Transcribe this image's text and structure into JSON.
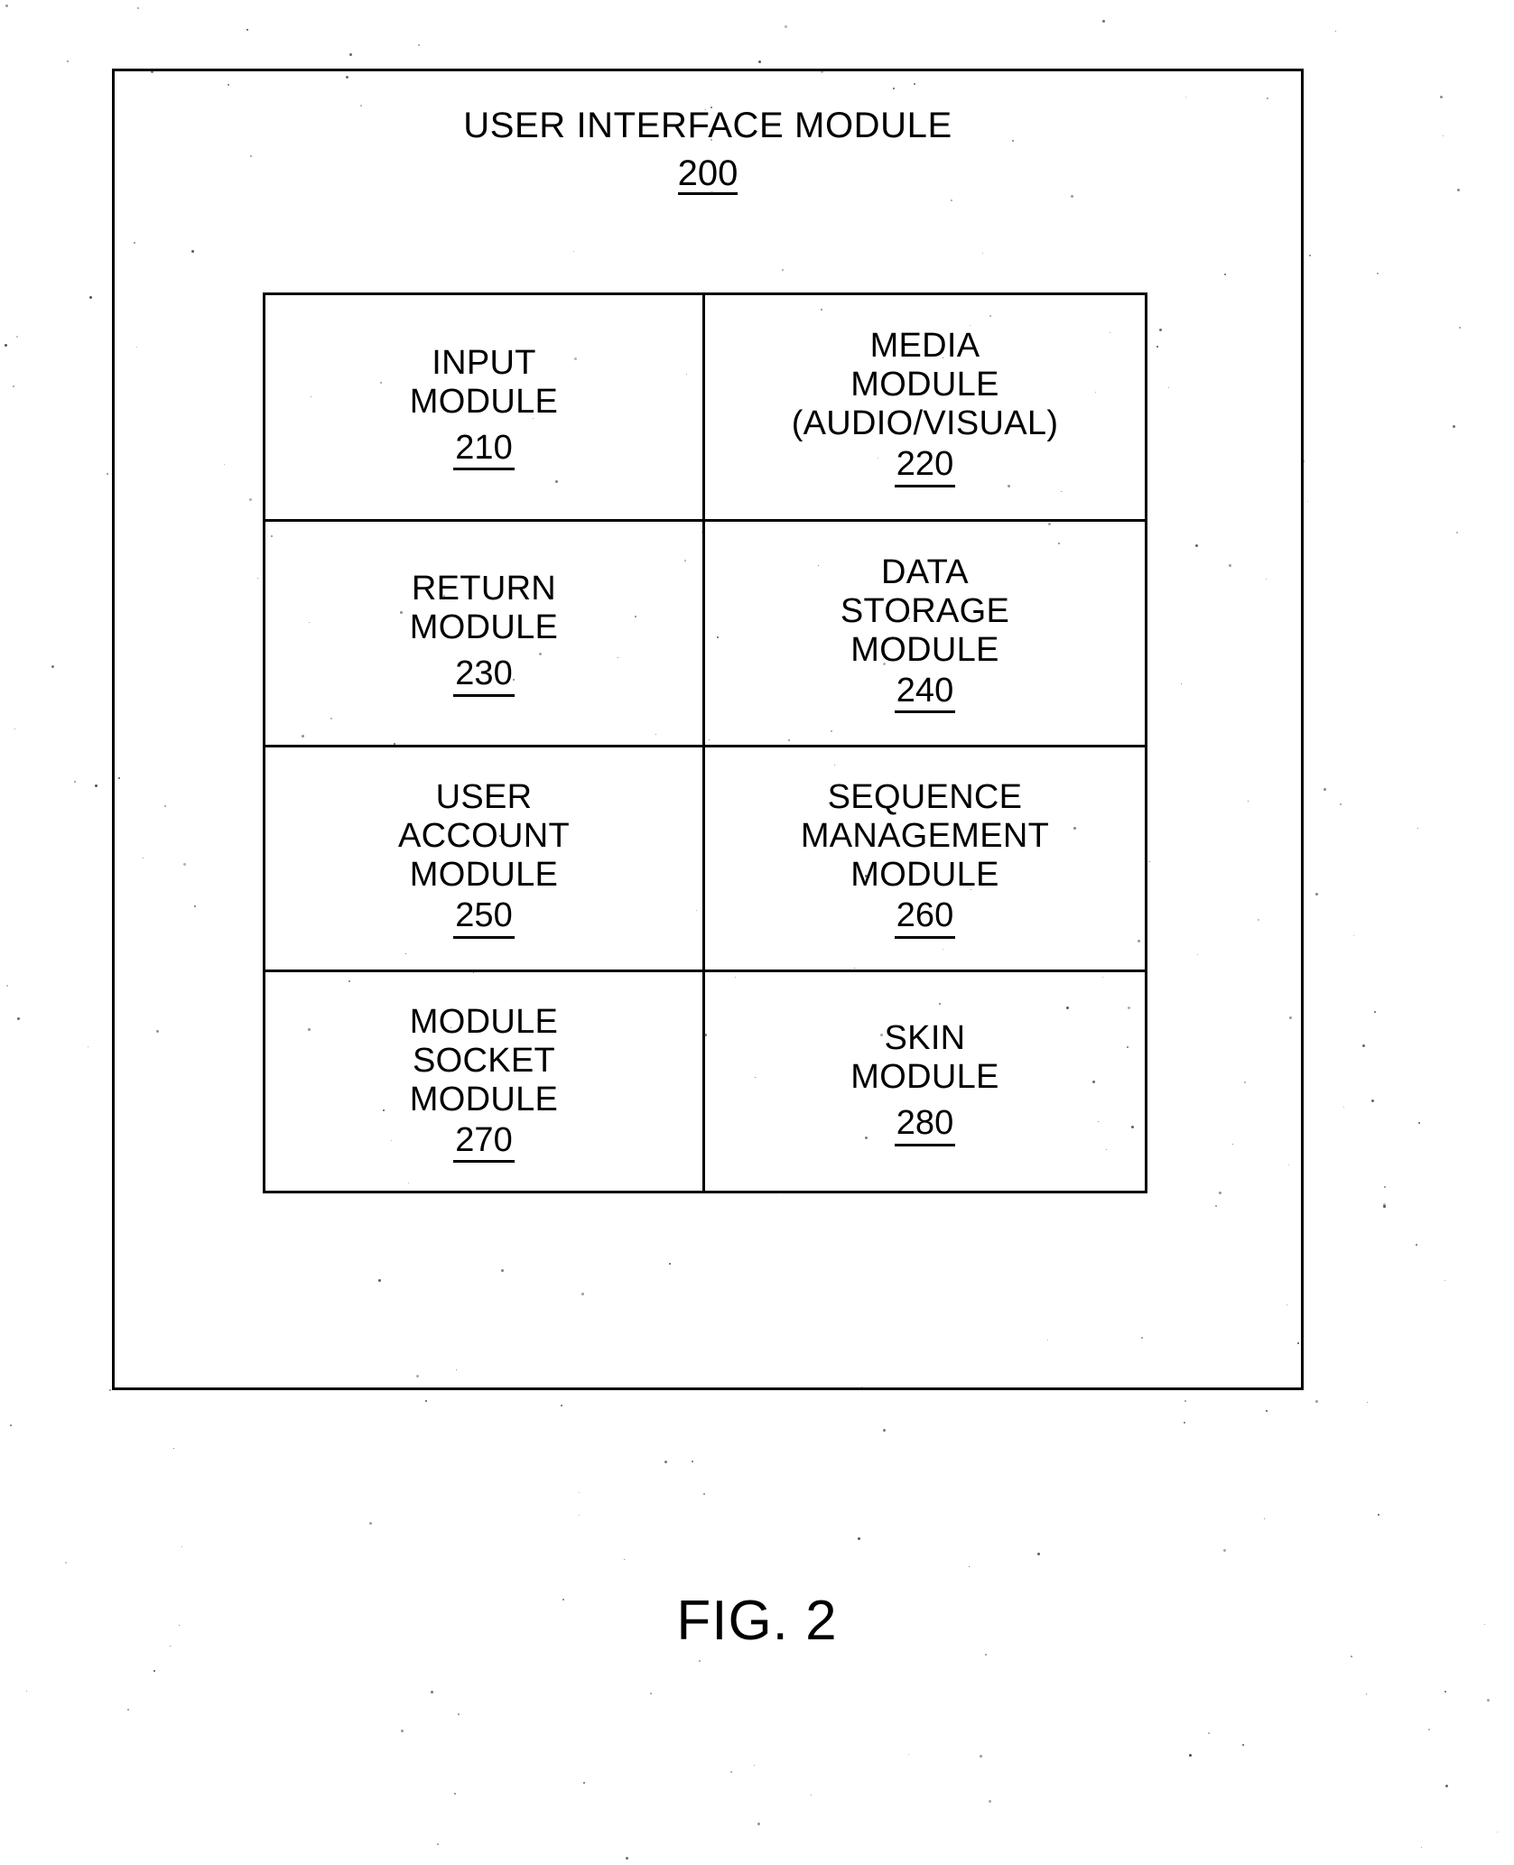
{
  "figure": {
    "heading_title": "USER INTERFACE MODULE",
    "heading_ref": "200",
    "caption": "FIG. 2"
  },
  "modules": [
    {
      "name": "INPUT\nMODULE",
      "ref": "210",
      "tight": false
    },
    {
      "name": "MEDIA\nMODULE\n(AUDIO/VISUAL)",
      "ref": "220",
      "tight": true
    },
    {
      "name": "RETURN\nMODULE",
      "ref": "230",
      "tight": false
    },
    {
      "name": "DATA\nSTORAGE\nMODULE",
      "ref": "240",
      "tight": true
    },
    {
      "name": "USER\nACCOUNT\nMODULE",
      "ref": "250",
      "tight": true
    },
    {
      "name": "SEQUENCE\nMANAGEMENT\nMODULE",
      "ref": "260",
      "tight": true
    },
    {
      "name": "MODULE\nSOCKET\nMODULE",
      "ref": "270",
      "tight": true
    },
    {
      "name": "SKIN\nMODULE",
      "ref": "280",
      "tight": false
    }
  ]
}
